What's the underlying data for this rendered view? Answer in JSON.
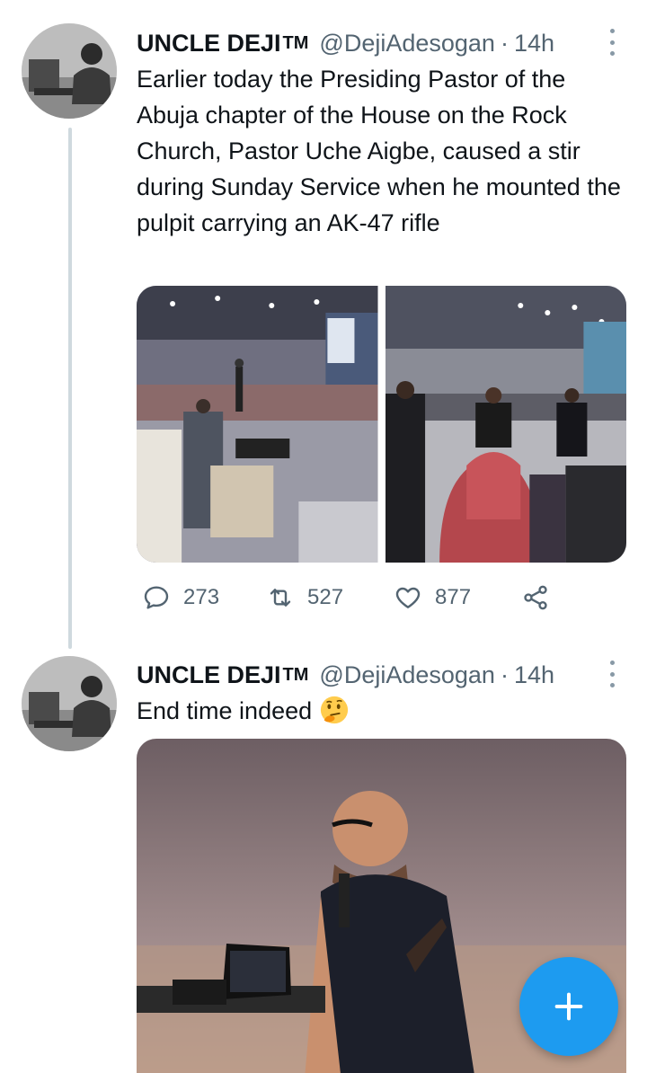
{
  "tweets": [
    {
      "author": {
        "display_name": "UNCLE DEJI",
        "badge": "TM",
        "handle": "@DejiAdesogan",
        "separator": "·",
        "time": "14h"
      },
      "text": "Earlier today the Presiding Pastor of the Abuja chapter of the House on the Rock Church, Pastor Uche Aigbe, caused a stir during Sunday Service when he mounted the pulpit carrying an AK-47 rifle",
      "media_count": 2,
      "stats": {
        "replies": "273",
        "retweets": "527",
        "likes": "877"
      },
      "icons": {
        "reply": "reply-icon",
        "retweet": "retweet-icon",
        "like": "heart-icon",
        "share": "share-icon",
        "more": "more-vertical-icon"
      }
    },
    {
      "author": {
        "display_name": "UNCLE DEJI",
        "badge": "TM",
        "handle": "@DejiAdesogan",
        "separator": "·",
        "time": "14h"
      },
      "text": "End time indeed",
      "emoji": "thinking-face",
      "media_count": 1
    }
  ],
  "fab": {
    "icon": "plus-icon",
    "color": "#1d9bf0"
  },
  "colors": {
    "accent": "#1d9bf0",
    "secondary_text": "#536471",
    "thread_line": "#cfd9de"
  }
}
